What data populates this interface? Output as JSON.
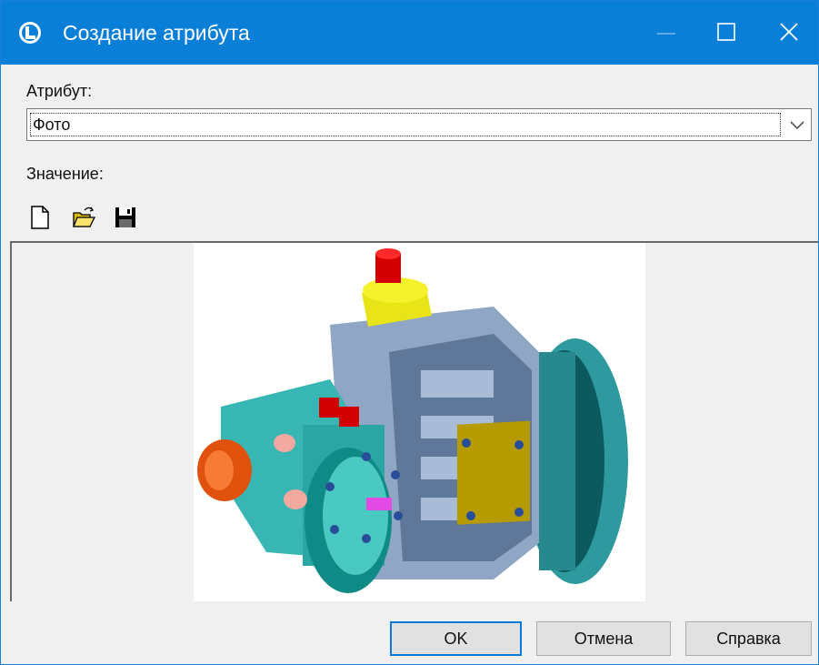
{
  "window": {
    "title": "Создание атрибута"
  },
  "titlebar": {
    "minimize_icon": "minimize-icon",
    "maximize_icon": "maximize-icon",
    "close_icon": "close-icon"
  },
  "form": {
    "attribute_label": "Атрибут:",
    "attribute_value": "Фото",
    "value_label": "Значение:"
  },
  "toolbar": {
    "icons": [
      "new-document-icon",
      "open-folder-icon",
      "save-icon"
    ]
  },
  "image": {
    "subject": "3d-pump-model-image"
  },
  "buttons": {
    "ok": "OK",
    "cancel": "Отмена",
    "help": "Справка"
  },
  "colors": {
    "titlebar": "#0a7fd8",
    "ok_border": "#0a78d7"
  }
}
